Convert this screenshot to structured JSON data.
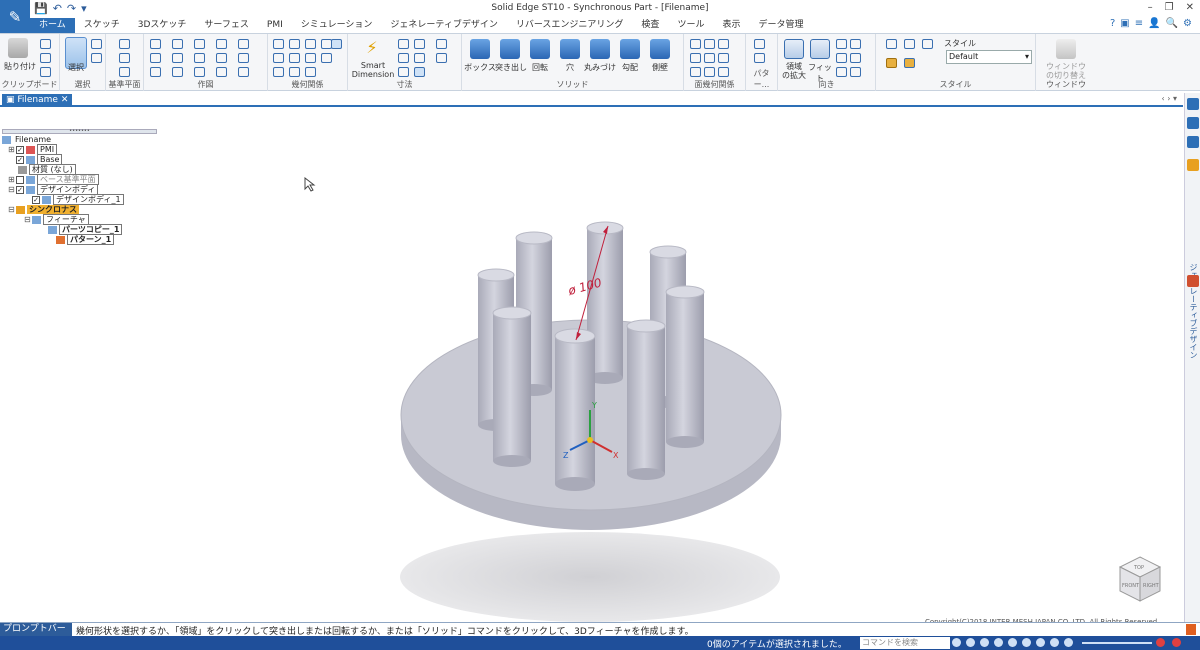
{
  "app": {
    "title": "Solid Edge ST10 - Synchronous Part - [Filename]",
    "window_controls": [
      "–",
      "❐",
      "✕"
    ]
  },
  "quick_access": [
    "💾",
    "↶",
    "↷",
    "▾"
  ],
  "tabs": [
    {
      "label": "ホーム",
      "active": true
    },
    {
      "label": "スケッチ"
    },
    {
      "label": "3Dスケッチ"
    },
    {
      "label": "サーフェス"
    },
    {
      "label": "PMI"
    },
    {
      "label": "シミュレーション"
    },
    {
      "label": "ジェネレーティブデザイン"
    },
    {
      "label": "リバースエンジニアリング"
    },
    {
      "label": "検査"
    },
    {
      "label": "ツール"
    },
    {
      "label": "表示"
    },
    {
      "label": "データ管理"
    }
  ],
  "help_icons": [
    "?",
    "▣",
    "≡",
    "👤",
    "🔍",
    "⚙"
  ],
  "ribbon": {
    "groups": [
      {
        "label": "クリップボード",
        "buttons": [
          "貼り付け"
        ]
      },
      {
        "label": "選択",
        "buttons": [
          "選択"
        ]
      },
      {
        "label": "基準平面"
      },
      {
        "label": "作図"
      },
      {
        "label": "幾何関係"
      },
      {
        "label": "寸法",
        "buttons": [
          "Smart",
          "Dimension"
        ]
      },
      {
        "label": "ソリッド",
        "buttons": [
          "ボックス",
          "突き出し",
          "回転",
          "穴",
          "丸みづけ",
          "勾配",
          "側壁"
        ]
      },
      {
        "label": "面幾何関係"
      },
      {
        "label": "パター..."
      },
      {
        "label": "向き",
        "buttons": [
          "領域",
          "の拡大",
          "フィット"
        ]
      },
      {
        "label": "スタイル",
        "buttons": [
          "スタイル"
        ],
        "style_value": "Default"
      },
      {
        "label": "ウィンドウ",
        "buttons": [
          "ウィンドウ",
          "の切り替え"
        ]
      }
    ]
  },
  "document_tab": {
    "label": "Filename",
    "close": "✕"
  },
  "doc_nav": "‹ › ▾",
  "pathfinder": {
    "items": [
      {
        "label": "Filename"
      },
      {
        "label": "PMI"
      },
      {
        "label": "Base"
      },
      {
        "label": "材質 (なし)"
      },
      {
        "label": "ベース基準平面"
      },
      {
        "label": "デザインボディ"
      },
      {
        "label": "デザインボディ_1"
      },
      {
        "label": "シンクロナス"
      },
      {
        "label": "フィーチャ"
      },
      {
        "label": "パーツコピー_1"
      },
      {
        "label": "パターン_1"
      }
    ]
  },
  "viewport": {
    "dimension_label": "ø 100",
    "triad": {
      "x": "X",
      "y": "Y",
      "z": "Z"
    },
    "viewcube": {
      "front": "FRONT",
      "right": "RIGHT",
      "top": "TOP"
    }
  },
  "right_panel": {
    "label": "ジェネレーティブデザイン"
  },
  "statusbar": {
    "prompt_label": "プロンプトバー",
    "prompt_text": "幾何形状を選択するか、「領域」をクリックして突き出しまたは回転するか、または「ソリッド」コマンドをクリックして、3Dフィーチャを作成します。",
    "selection_count": "0個のアイテムが選択されました。",
    "command_search_placeholder": "コマンドを検索",
    "copyright": "Copyright(C)2018 INTER MESH JAPAN CO.,LTD. All Rights Reserved"
  },
  "colors": {
    "accent": "#2d6fb6",
    "highlight": "#f0b030",
    "model": "#c7c8d2",
    "dimension": "#c0203c"
  }
}
